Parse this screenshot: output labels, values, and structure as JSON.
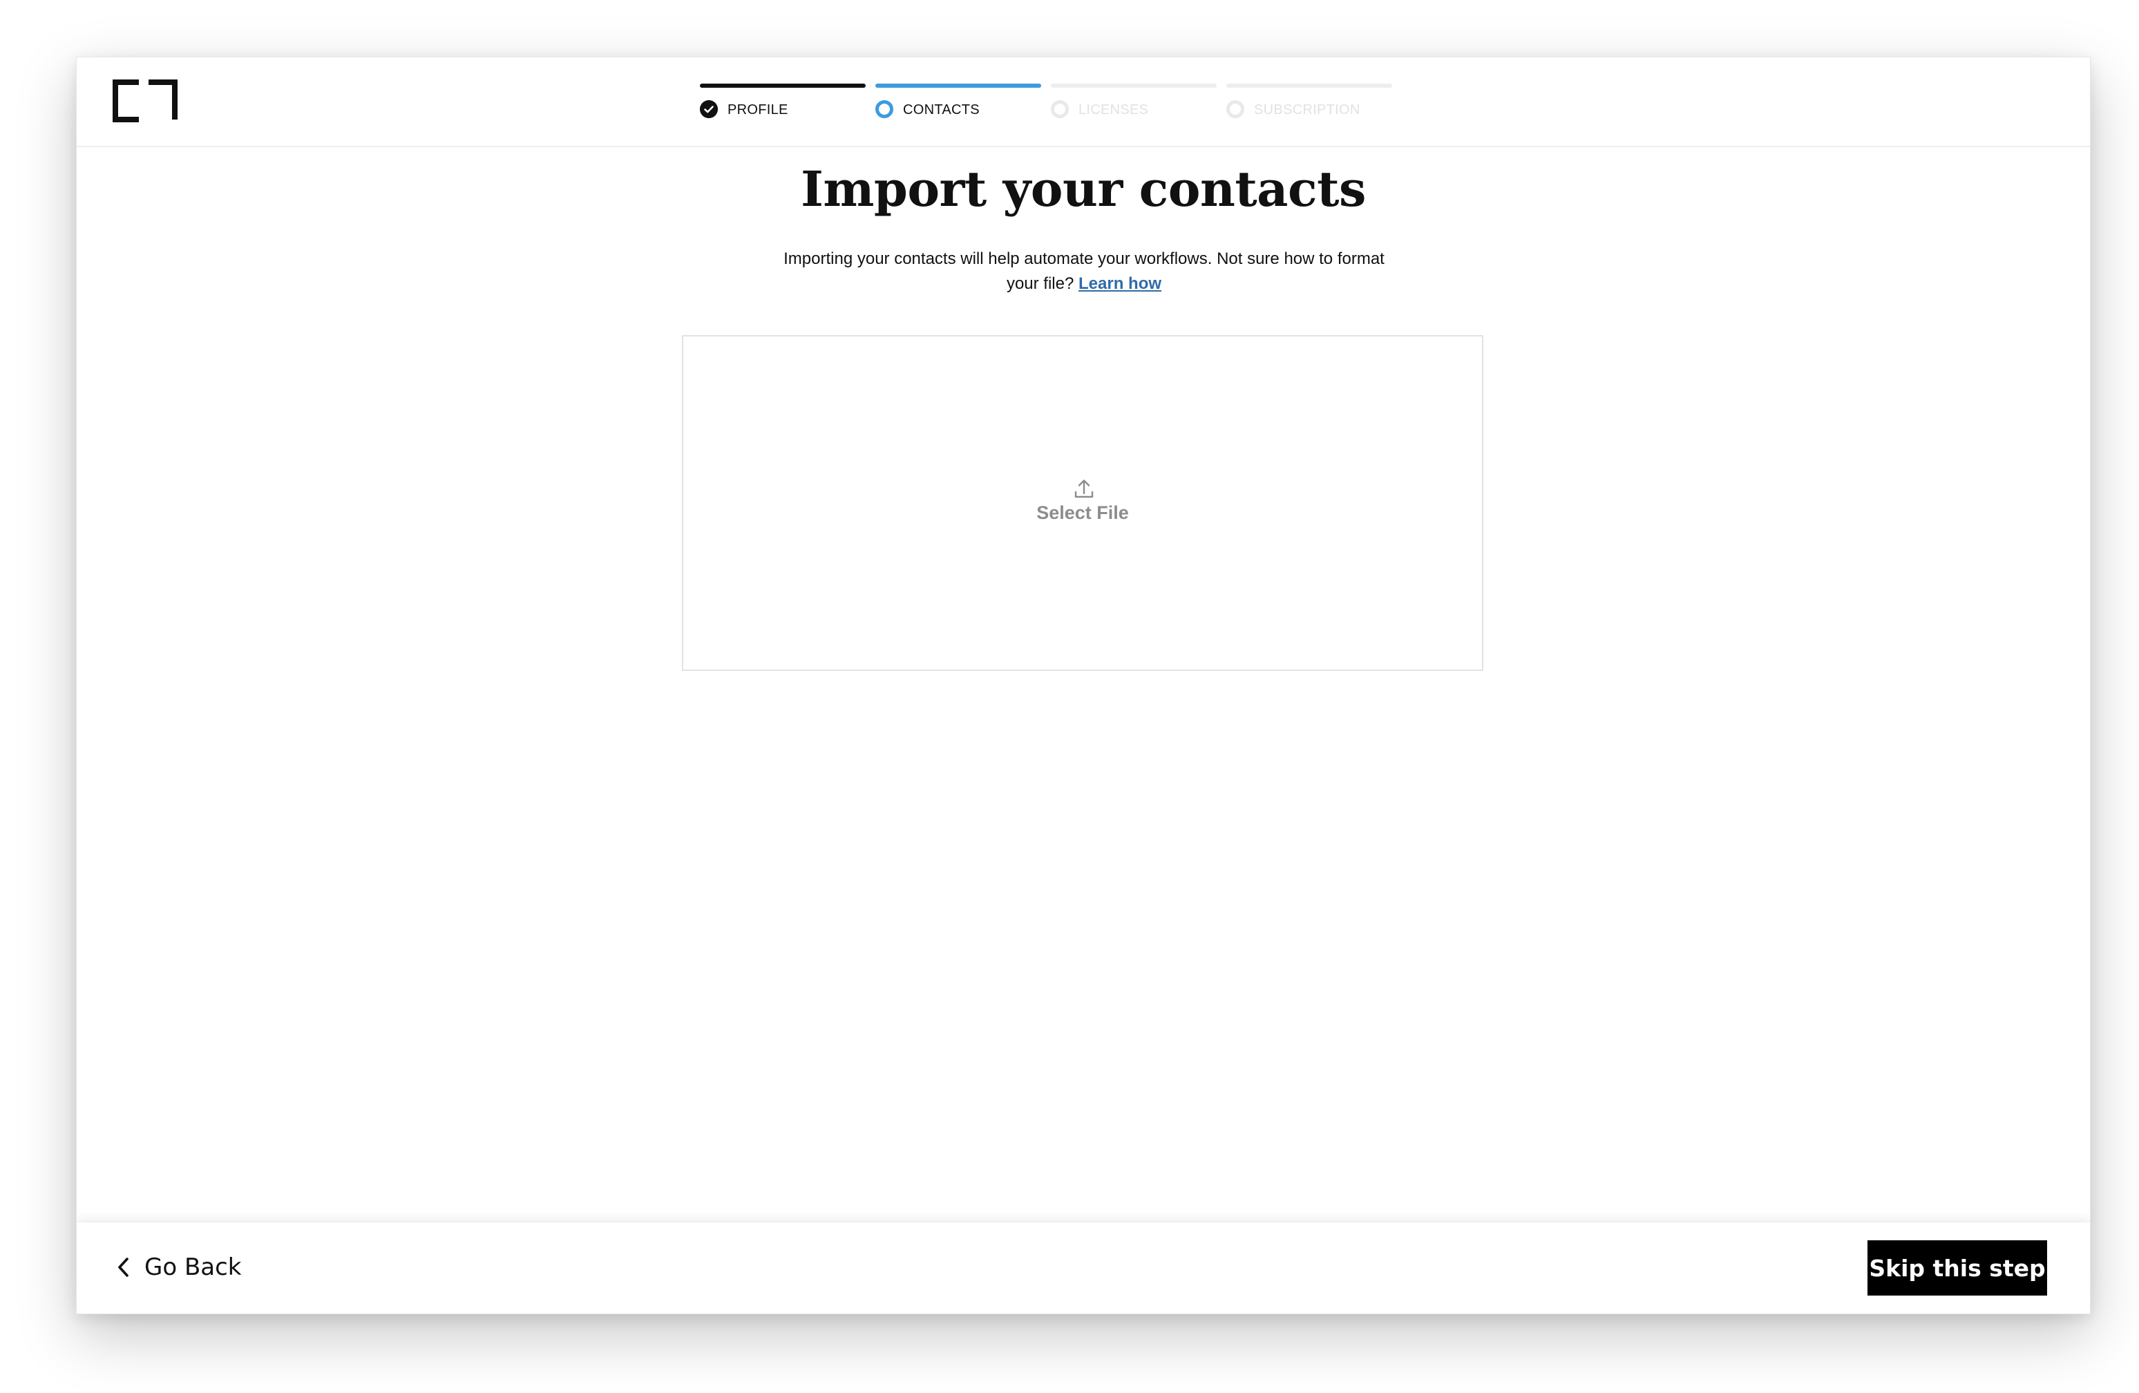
{
  "header": {
    "logo_icon": "bracket-logo-icon",
    "steps": [
      {
        "label": "PROFILE",
        "state": "completed",
        "icon": "check-circle-icon"
      },
      {
        "label": "CONTACTS",
        "state": "current",
        "icon": "circle-icon"
      },
      {
        "label": "LICENSES",
        "state": "upcoming",
        "icon": "circle-icon"
      },
      {
        "label": "SUBSCRIPTION",
        "state": "upcoming",
        "icon": "circle-icon"
      }
    ]
  },
  "main": {
    "title": "Import your contacts",
    "description": "Importing your contacts will help automate your workflows. Not sure how to format your file?",
    "learn_link": "Learn how",
    "dropzone": {
      "icon": "upload-icon",
      "label": "Select File"
    }
  },
  "footer": {
    "back_icon": "chevron-left-icon",
    "back_label": "Go Back",
    "skip_label": "Skip this step"
  },
  "colors": {
    "accent": "#3d9bdf",
    "primary": "#111111",
    "link": "#2f6ba8",
    "muted": "#8c8c8c"
  }
}
